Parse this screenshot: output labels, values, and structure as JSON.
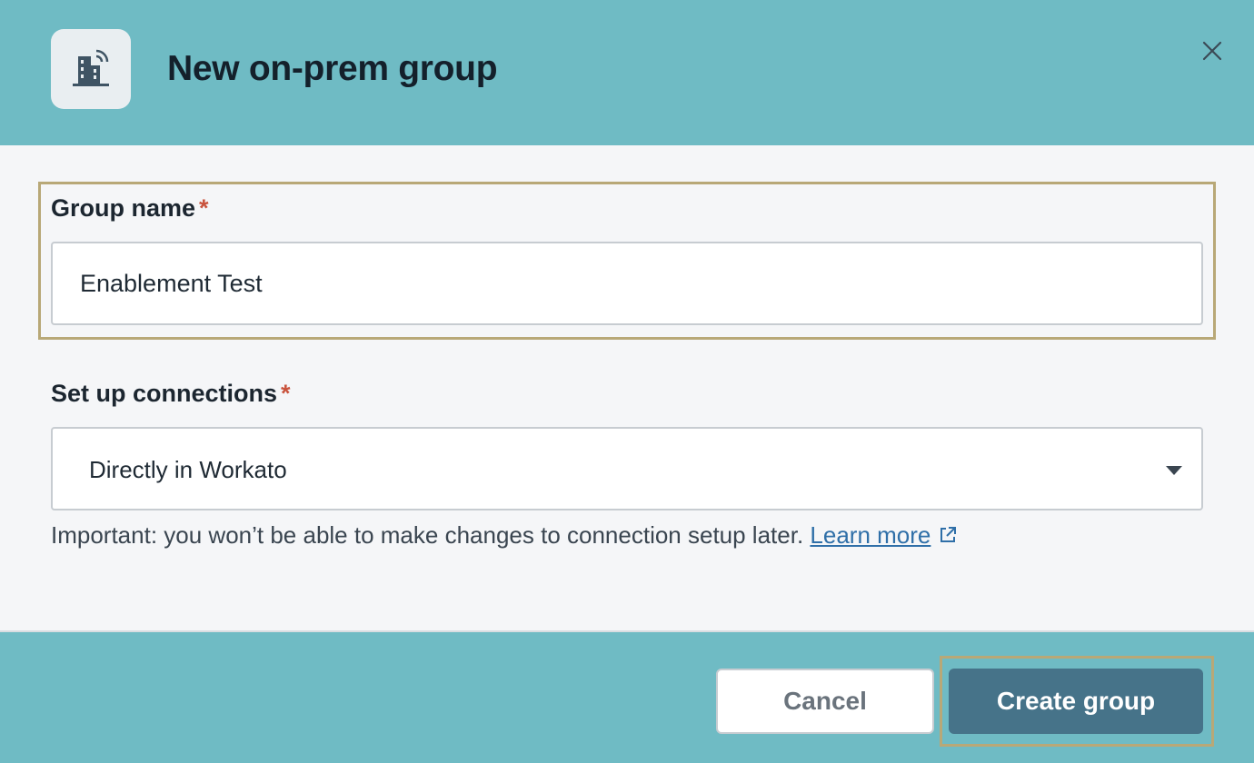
{
  "header": {
    "title": "New on-prem group",
    "icon": "on-prem-building-signal-icon",
    "close_icon": "close-icon"
  },
  "form": {
    "group_name": {
      "label": "Group name",
      "required_mark": "*",
      "value": "Enablement Test"
    },
    "connections": {
      "label": "Set up connections",
      "required_mark": "*",
      "selected": "Directly in Workato",
      "helper_text": "Important: you won’t be able to make changes to connection setup later.",
      "learn_more": "Learn more"
    }
  },
  "footer": {
    "cancel_label": "Cancel",
    "create_label": "Create group"
  },
  "colors": {
    "header_bg": "#6fbbc4",
    "primary_button": "#467389",
    "required": "#c9533d",
    "link": "#2f6fa8",
    "highlight_border": "#b8a877"
  }
}
